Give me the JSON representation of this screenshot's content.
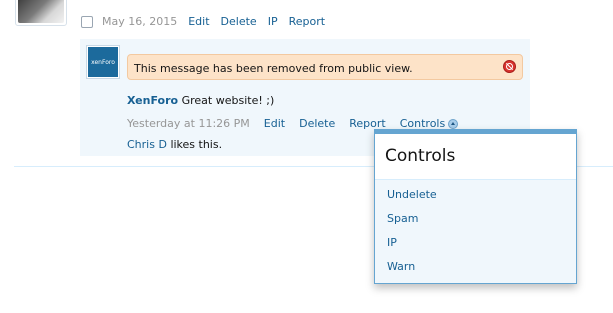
{
  "top_post": {
    "date": "May 16, 2015",
    "actions": [
      "Edit",
      "Delete",
      "IP",
      "Report"
    ]
  },
  "comment": {
    "avatar_logo_text": "xenForo",
    "deleted_notice": "This message has been removed from public view.",
    "author": "XenForo",
    "message": "Great website! ;)",
    "date": "Yesterday at 11:26 PM",
    "actions": [
      "Edit",
      "Delete",
      "Report"
    ],
    "controls_label": "Controls",
    "likes": {
      "liker": "Chris D",
      "suffix": "likes this."
    }
  },
  "controls_menu": {
    "title": "Controls",
    "items": [
      "Undelete",
      "Spam",
      "IP",
      "Warn"
    ]
  },
  "colors": {
    "link": "#176093",
    "muted": "#969696",
    "comment_bg": "#f0f7fc",
    "notice_bg": "#fde3c8",
    "menu_border": "#65a5d1"
  },
  "icons": {
    "top_avatar": "user-avatar",
    "xf_avatar": "xenforo-logo",
    "deleted": "deleted-prohibited-icon",
    "controls_arrow": "chevron-up-icon"
  }
}
